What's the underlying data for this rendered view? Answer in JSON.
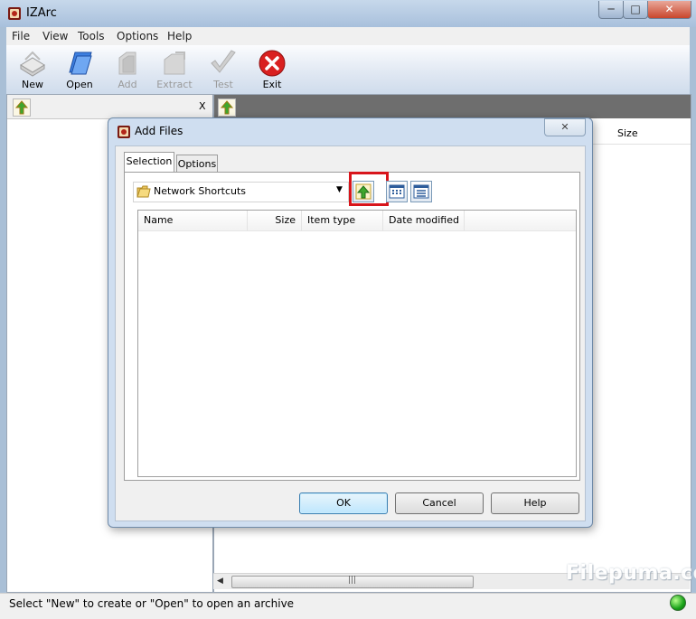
{
  "window": {
    "title": "IZArc",
    "minimize": "─",
    "maximize": "□",
    "close": "✕"
  },
  "menu": [
    "File",
    "View",
    "Tools",
    "Options",
    "Help"
  ],
  "toolbar": {
    "new": "New",
    "open": "Open",
    "add": "Add",
    "extract": "Extract",
    "test": "Test",
    "exit": "Exit"
  },
  "left_pane": {
    "close_label": "X"
  },
  "right_pane": {
    "size_column": "Size"
  },
  "dialog": {
    "title": "Add Files",
    "close": "✕",
    "tabs": {
      "selection": "Selection",
      "options": "Options"
    },
    "path": "Network Shortcuts",
    "columns": {
      "name": "Name",
      "size": "Size",
      "item_type": "Item type",
      "date_modified": "Date modified"
    },
    "buttons": {
      "ok": "OK",
      "cancel": "Cancel",
      "help": "Help"
    }
  },
  "status": {
    "text": "Select \"New\" to create or \"Open\" to open an archive"
  },
  "watermark": "Filepuma.com",
  "colors": {
    "highlight": "#d8151b",
    "exit_red": "#d92020",
    "status_green": "#1aa31a"
  }
}
